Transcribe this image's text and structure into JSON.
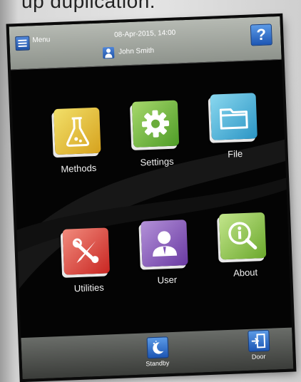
{
  "caption": "up duplication.",
  "header": {
    "menu_label": "Menu",
    "datetime": "08-Apr-2015, 14:00",
    "user_name": "John Smith",
    "help_label": "?"
  },
  "tiles": [
    {
      "label": "Methods",
      "icon": "flask-icon",
      "color": "#e8c23a"
    },
    {
      "label": "Settings",
      "icon": "gear-icon",
      "color": "#7bbf3f"
    },
    {
      "label": "File",
      "icon": "folder-icon",
      "color": "#4db7dc"
    },
    {
      "label": "Utilities",
      "icon": "tools-icon",
      "color": "#e0433d"
    },
    {
      "label": "User",
      "icon": "user-icon",
      "color": "#8a5ab7"
    },
    {
      "label": "About",
      "icon": "info-search-icon",
      "color": "#8cc24a"
    }
  ],
  "footer": {
    "standby_label": "Standby",
    "door_label": "Door"
  }
}
